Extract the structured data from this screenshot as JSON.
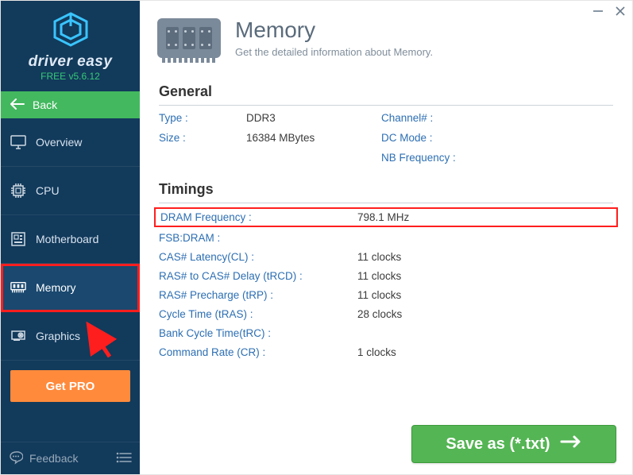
{
  "brand": {
    "name": "driver easy",
    "version": "FREE v5.6.12"
  },
  "sidebar": {
    "back_label": "Back",
    "items": [
      {
        "label": "Overview",
        "icon": "monitor-icon"
      },
      {
        "label": "CPU",
        "icon": "cpu-icon"
      },
      {
        "label": "Motherboard",
        "icon": "motherboard-icon"
      },
      {
        "label": "Memory",
        "icon": "memory-icon"
      },
      {
        "label": "Graphics",
        "icon": "graphics-icon"
      }
    ],
    "get_pro_label": "Get PRO",
    "feedback_label": "Feedback"
  },
  "page": {
    "title": "Memory",
    "subtitle": "Get the detailed information about Memory."
  },
  "sections": {
    "general_title": "General",
    "general": {
      "type_label": "Type :",
      "type_value": "DDR3",
      "channel_label": "Channel# :",
      "channel_value": "",
      "size_label": "Size :",
      "size_value": "16384 MBytes",
      "dcmode_label": "DC Mode :",
      "dcmode_value": "",
      "nbfreq_label": "NB Frequency :",
      "nbfreq_value": ""
    },
    "timings_title": "Timings",
    "timings": [
      {
        "label": "DRAM Frequency :",
        "value": "798.1 MHz",
        "highlight": true
      },
      {
        "label": "FSB:DRAM :",
        "value": ""
      },
      {
        "label": "CAS# Latency(CL) :",
        "value": "11 clocks"
      },
      {
        "label": "RAS# to CAS# Delay (tRCD) :",
        "value": "11 clocks"
      },
      {
        "label": "RAS# Precharge (tRP) :",
        "value": "11 clocks"
      },
      {
        "label": "Cycle Time (tRAS) :",
        "value": "28 clocks"
      },
      {
        "label": "Bank Cycle Time(tRC) :",
        "value": ""
      },
      {
        "label": "Command Rate (CR) :",
        "value": "1 clocks"
      }
    ]
  },
  "save_button_label": "Save as (*.txt)"
}
